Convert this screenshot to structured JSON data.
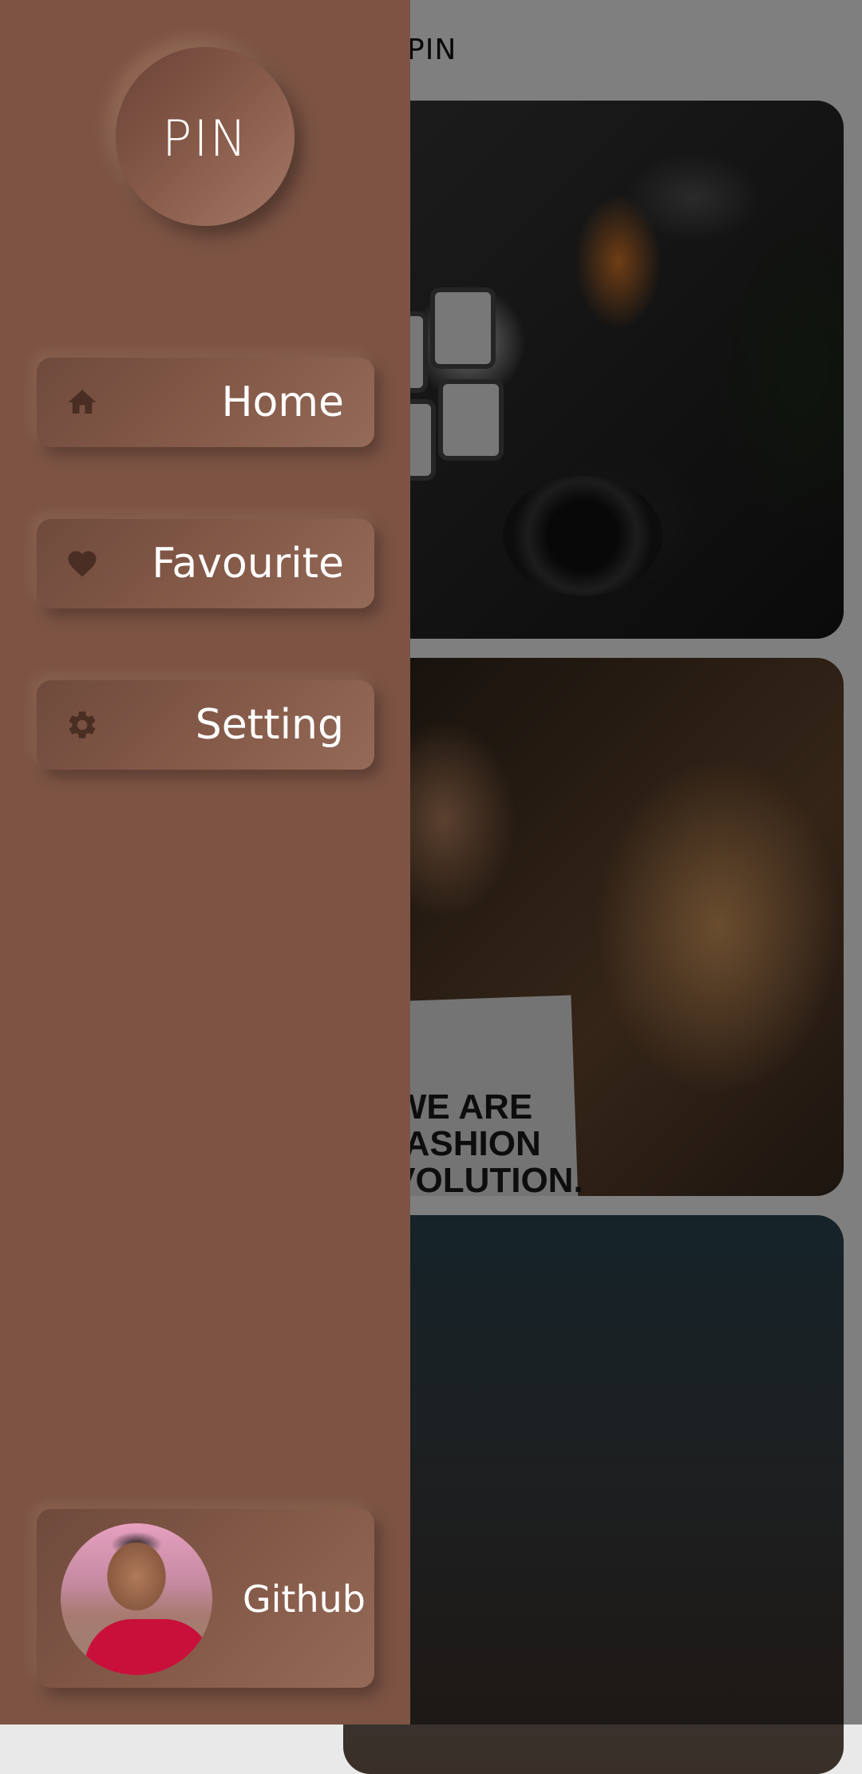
{
  "app": {
    "title": "PIN"
  },
  "drawer": {
    "logo_text": "PIN",
    "items": [
      {
        "label": "Home",
        "icon": "home-icon"
      },
      {
        "label": "Favourite",
        "icon": "heart-icon"
      },
      {
        "label": "Setting",
        "icon": "gear-icon"
      }
    ],
    "github": {
      "label": "Github"
    }
  },
  "feed": {
    "cards": [
      {
        "id": "camera-gear"
      },
      {
        "id": "fashion-revolution",
        "sign_text": "WE ARE FASHION REVOLUTION."
      },
      {
        "id": "dark-gradient"
      }
    ]
  },
  "colors": {
    "drawer_bg": "#7d5444",
    "button_bg": "#855a49",
    "icon_color": "#4a2e24",
    "text_color": "#ffffff"
  }
}
